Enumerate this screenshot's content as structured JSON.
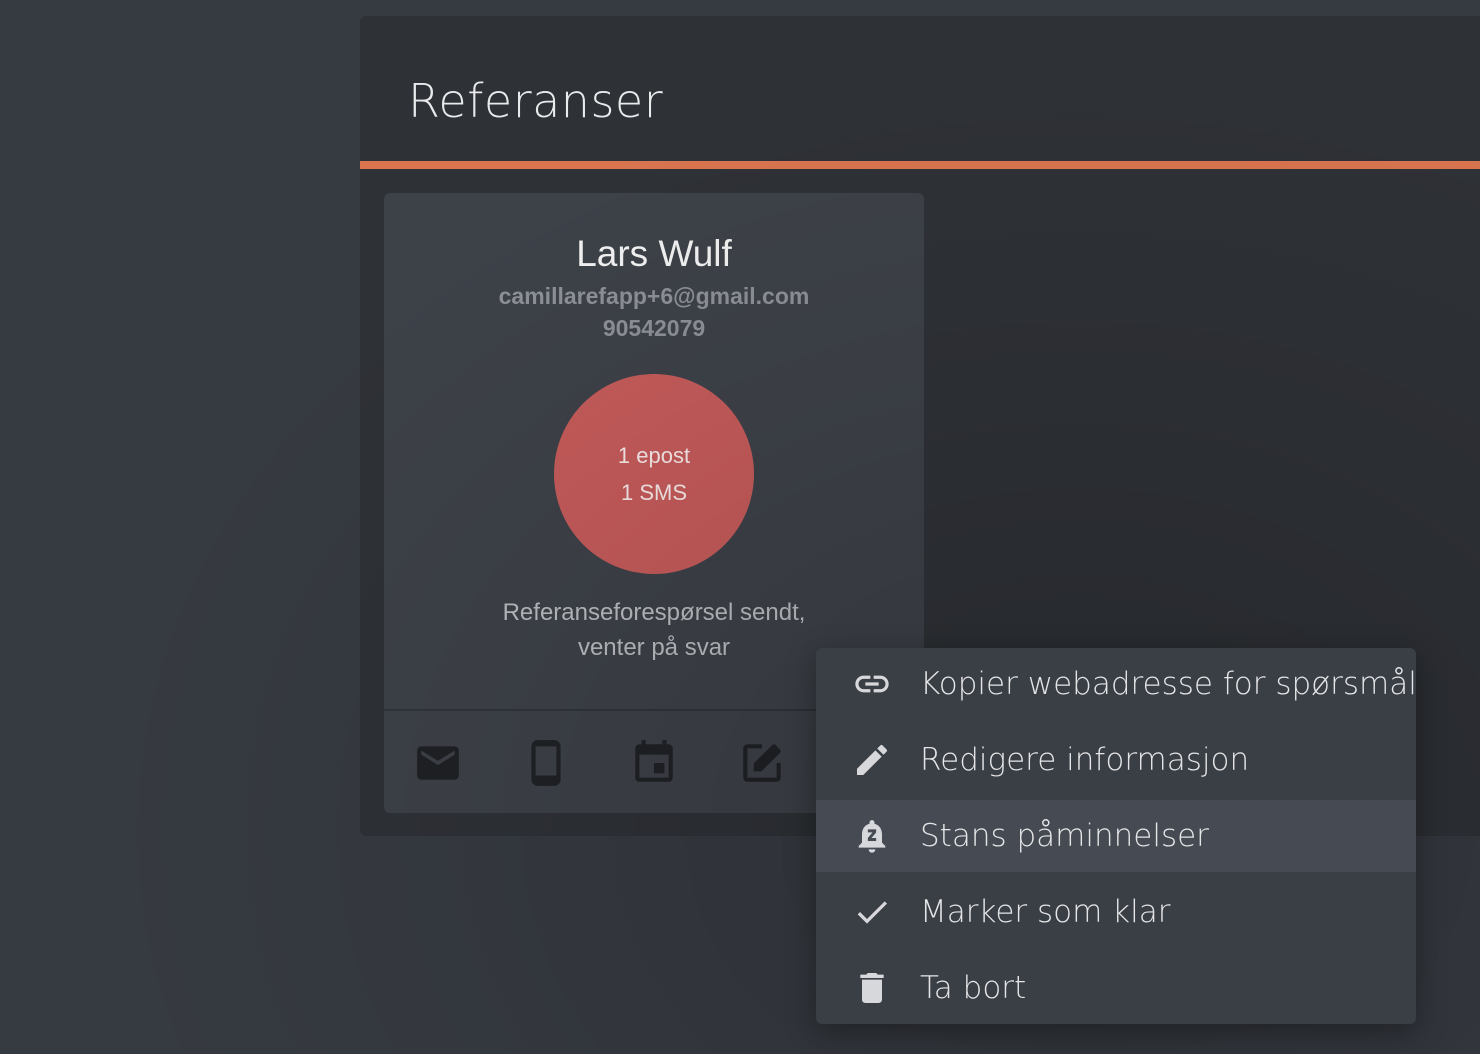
{
  "page": {
    "title": "Referanser",
    "accent_color": "#d9744f"
  },
  "reference_card": {
    "name": "Lars Wulf",
    "email": "camillarefapp+6@gmail.com",
    "phone": "90542079",
    "status_counts": {
      "email": "1 epost",
      "sms": "1 SMS"
    },
    "status_color": "#c45b5a",
    "status_text_line1": "Referanseforespørsel sendt,",
    "status_text_line2": "venter på svar",
    "actions": [
      {
        "icon": "email-icon"
      },
      {
        "icon": "phone-icon"
      },
      {
        "icon": "calendar-icon"
      },
      {
        "icon": "edit-icon"
      }
    ]
  },
  "context_menu": {
    "items": [
      {
        "label": "Kopier webadresse for spørsmål",
        "icon": "link-icon"
      },
      {
        "label": "Redigere informasjon",
        "icon": "pencil-icon"
      },
      {
        "label": "Stans påminnelser",
        "icon": "snooze-bell-icon",
        "highlighted": true
      },
      {
        "label": "Marker som klar",
        "icon": "check-icon"
      },
      {
        "label": "Ta bort",
        "icon": "trash-icon"
      }
    ]
  }
}
